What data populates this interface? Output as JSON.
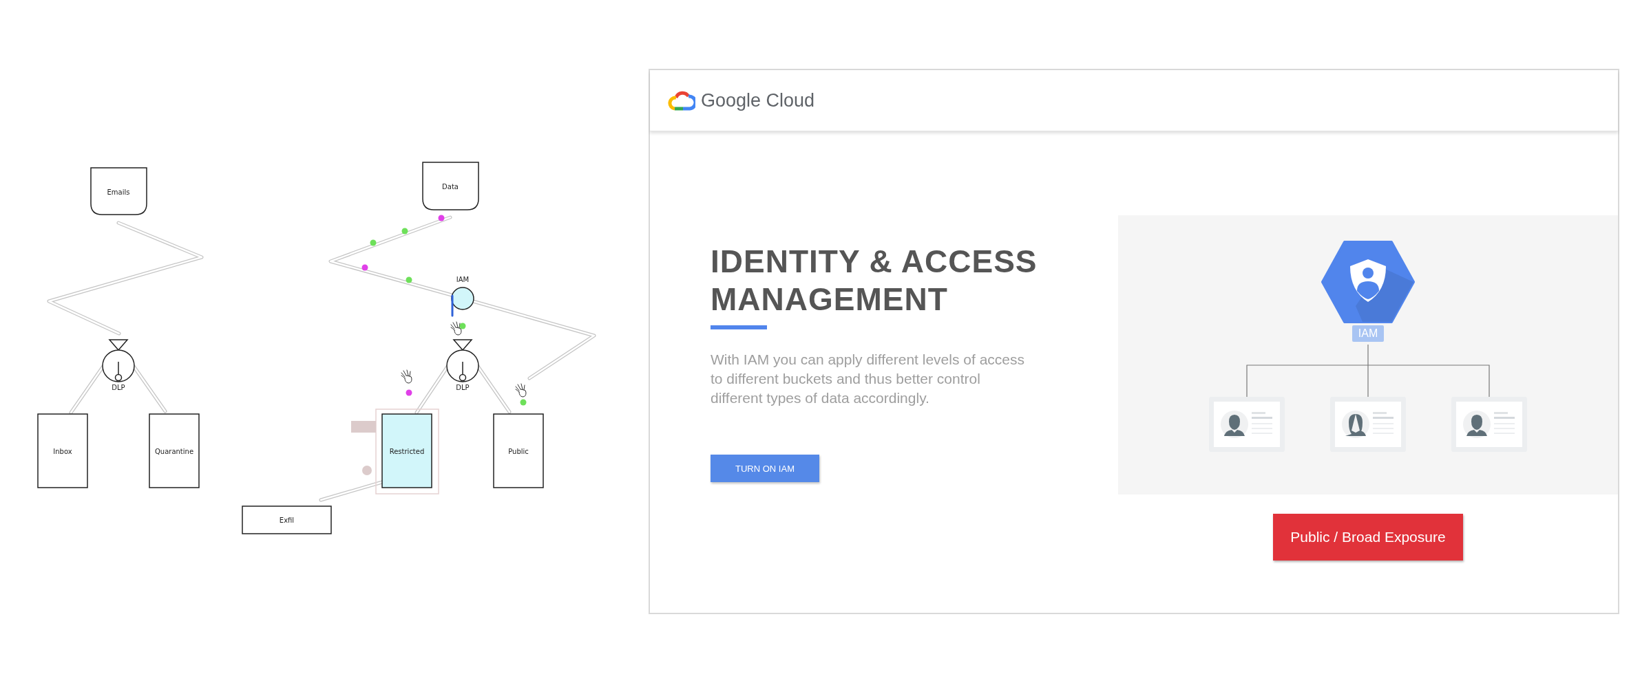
{
  "diagram": {
    "sources": [
      {
        "label": "Emails"
      },
      {
        "label": "Data"
      }
    ],
    "gates": [
      {
        "kind": "dlp",
        "label": "DLP"
      },
      {
        "kind": "dlp",
        "label": "DLP"
      },
      {
        "kind": "iam",
        "label": "IAM"
      }
    ],
    "buckets": [
      {
        "label": "Inbox",
        "selected": false
      },
      {
        "label": "Quarantine",
        "selected": false
      },
      {
        "label": "Restricted",
        "selected": true
      },
      {
        "label": "Public",
        "selected": false
      },
      {
        "label": "Exfil",
        "selected": false
      }
    ],
    "packets": [
      {
        "color": "#e040e8"
      },
      {
        "color": "#6ee05a"
      },
      {
        "color": "#6ee05a"
      },
      {
        "color": "#e040e8"
      },
      {
        "color": "#6ee05a"
      }
    ],
    "grabbed_packets": [
      {
        "color": "#6ee05a"
      },
      {
        "color": "#e040e8"
      },
      {
        "color": "#6ee05a"
      }
    ]
  },
  "card": {
    "brand": "Google Cloud",
    "title": "IDENTITY & ACCESS MANAGEMENT",
    "description": "With IAM you can apply different levels of access to different buckets and thus better control different types of data accordingly.",
    "button": "TURN ON IAM",
    "illustration_label": "IAM",
    "alert_button": "Public / Broad Exposure"
  }
}
